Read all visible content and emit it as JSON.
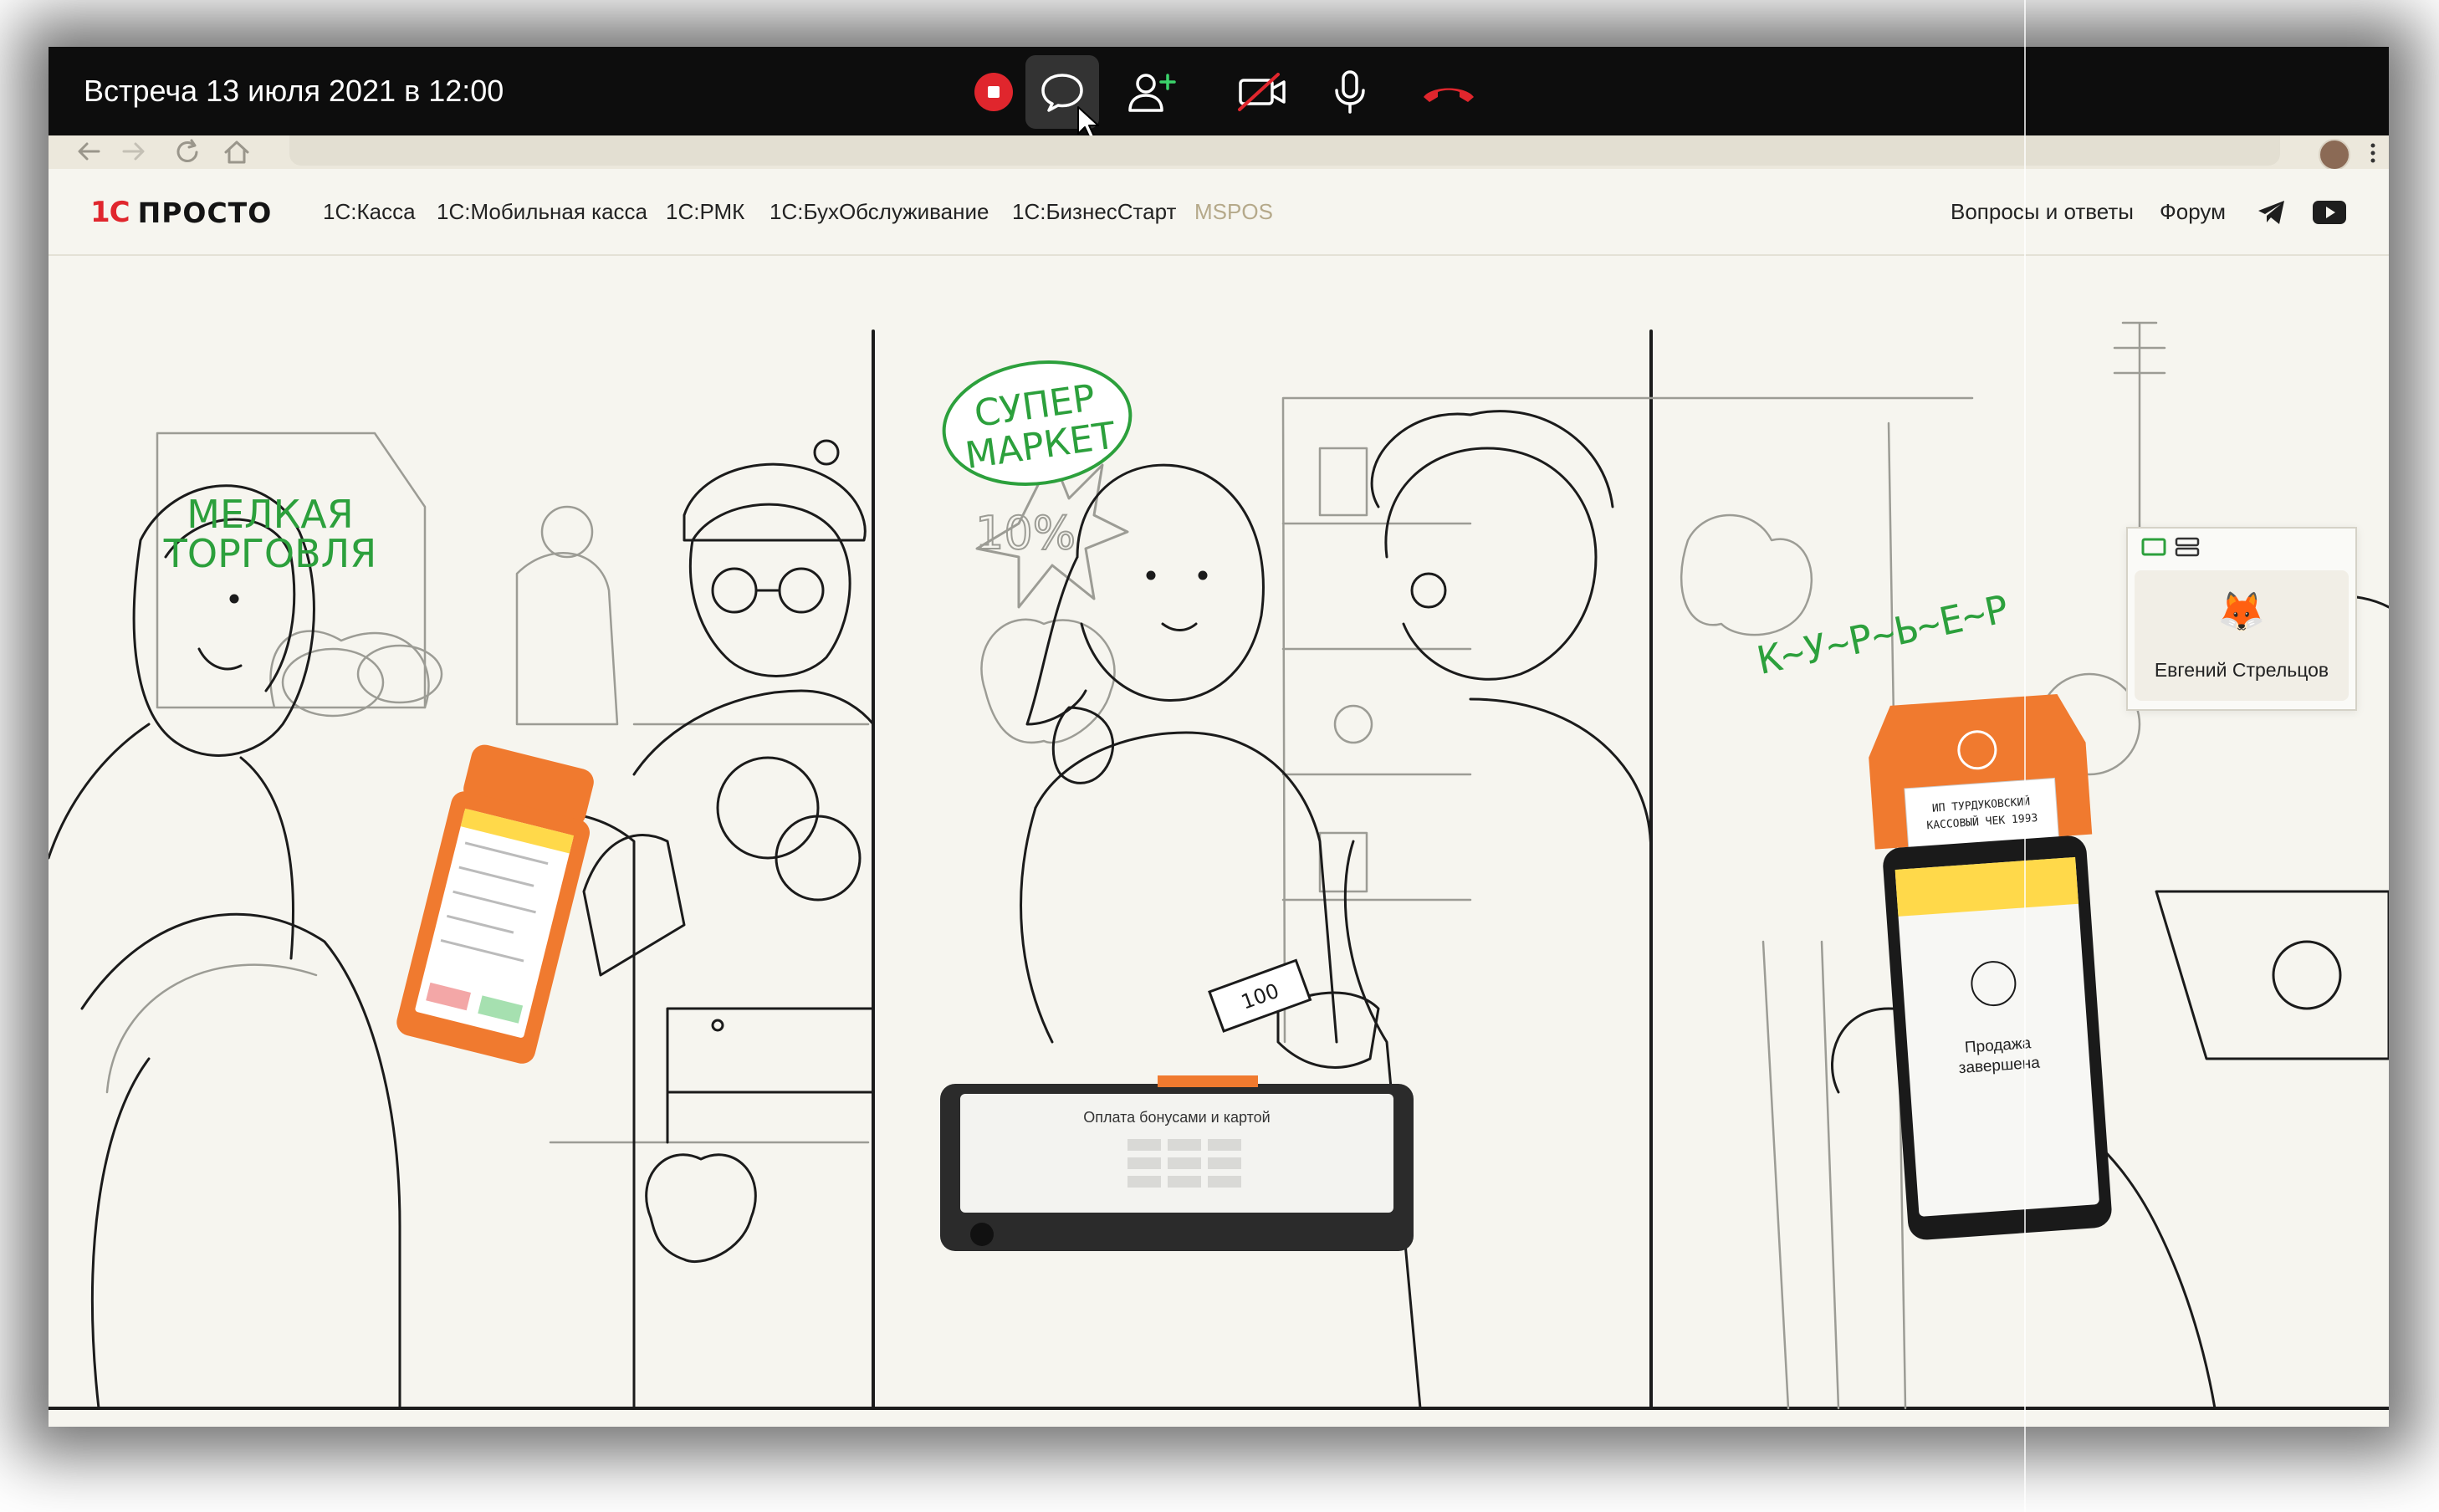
{
  "meeting": {
    "title": "Встреча 13 июля 2021 в 12:00",
    "controls": [
      "stop-recording",
      "chat",
      "add-participant",
      "camera-off",
      "microphone",
      "end-call"
    ]
  },
  "site": {
    "logo_mark": "1С",
    "logo_text": "ПРОСТО",
    "menu": [
      "1С:Касса",
      "1С:Мобильная касса",
      "1С:РМК",
      "1С:БухОбслуживание",
      "1С:БизнесСтарт",
      "MSPOS"
    ],
    "right_links": [
      "Вопросы и ответы",
      "Форум"
    ]
  },
  "hero": {
    "labels": {
      "small_trade": [
        "МЕЛКАЯ",
        "ТОРГОВЛЯ"
      ],
      "supermarket": [
        "СУПЕР",
        "МАРКЕТ"
      ],
      "discount": "10%",
      "courier": "К~У~Р~Ь~Е~Р"
    },
    "receipt": [
      "ИП ТУРДУКОВСКИЙ",
      "КАССОВЫЙ ЧЕК 1993"
    ],
    "pos_screen_title": "Оплата бонусами и картой",
    "phone_screen_text": [
      "Продажа",
      "завершена"
    ],
    "banknote": "100"
  },
  "participant": {
    "emoji": "🦊",
    "name": "Евгений Стрельцов"
  },
  "colors": {
    "topbar": "#0d0d0d",
    "page_bg": "#f6f5ef",
    "brand_red": "#e0262d",
    "hand_green": "#2ca03c",
    "terminal_orange": "#f07a2f",
    "end_call": "#e0262d"
  }
}
